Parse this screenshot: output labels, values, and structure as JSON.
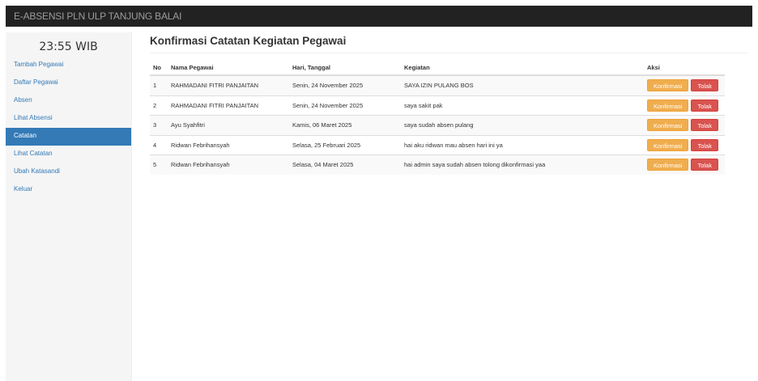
{
  "navbar": {
    "brand": "E-ABSENSI PLN ULP TANJUNG BALAI"
  },
  "sidebar": {
    "clock": "23:55 WIB",
    "items": [
      {
        "label": "Tambah Pegawai"
      },
      {
        "label": "Daftar Pegawai"
      },
      {
        "label": "Absen"
      },
      {
        "label": "Lihat Absensi"
      },
      {
        "label": "Catatan"
      },
      {
        "label": "Lihat Catatan"
      },
      {
        "label": "Ubah Katasandi"
      },
      {
        "label": "Keluar"
      }
    ],
    "active_index": 4
  },
  "main": {
    "title": "Konfirmasi Catatan Kegiatan Pegawai",
    "table": {
      "headers": [
        "No",
        "Nama Pegawai",
        "Hari, Tanggal",
        "Kegiatan",
        "Aksi"
      ],
      "rows": [
        [
          "1",
          "RAHMADANI FITRI PANJAITAN",
          "Senin, 24 November 2025",
          "SAYA IZIN PULANG BOS"
        ],
        [
          "2",
          "RAHMADANI FITRI PANJAITAN",
          "Senin, 24 November 2025",
          "saya sakit pak"
        ],
        [
          "3",
          "Ayu Syahfitri",
          "Kamis, 06 Maret 2025",
          "saya sudah absen pulang"
        ],
        [
          "4",
          "Ridwan Febrihansyah",
          "Selasa, 25 Februari 2025",
          "hai aku ridwan mau absen hari ini ya"
        ],
        [
          "5",
          "Ridwan Febrihansyah",
          "Selasa, 04 Maret 2025",
          "hai admin saya sudah absen tolong dikonfirmasi yaa"
        ]
      ],
      "confirm_label": "Konfirmasi",
      "reject_label": "Tolak"
    }
  },
  "colors": {
    "navbar_bg": "#222222",
    "sidebar_bg": "#f5f5f5",
    "link": "#337ab7",
    "active_bg": "#337ab7",
    "confirm": "#f0ad4e",
    "reject": "#d9534f"
  }
}
